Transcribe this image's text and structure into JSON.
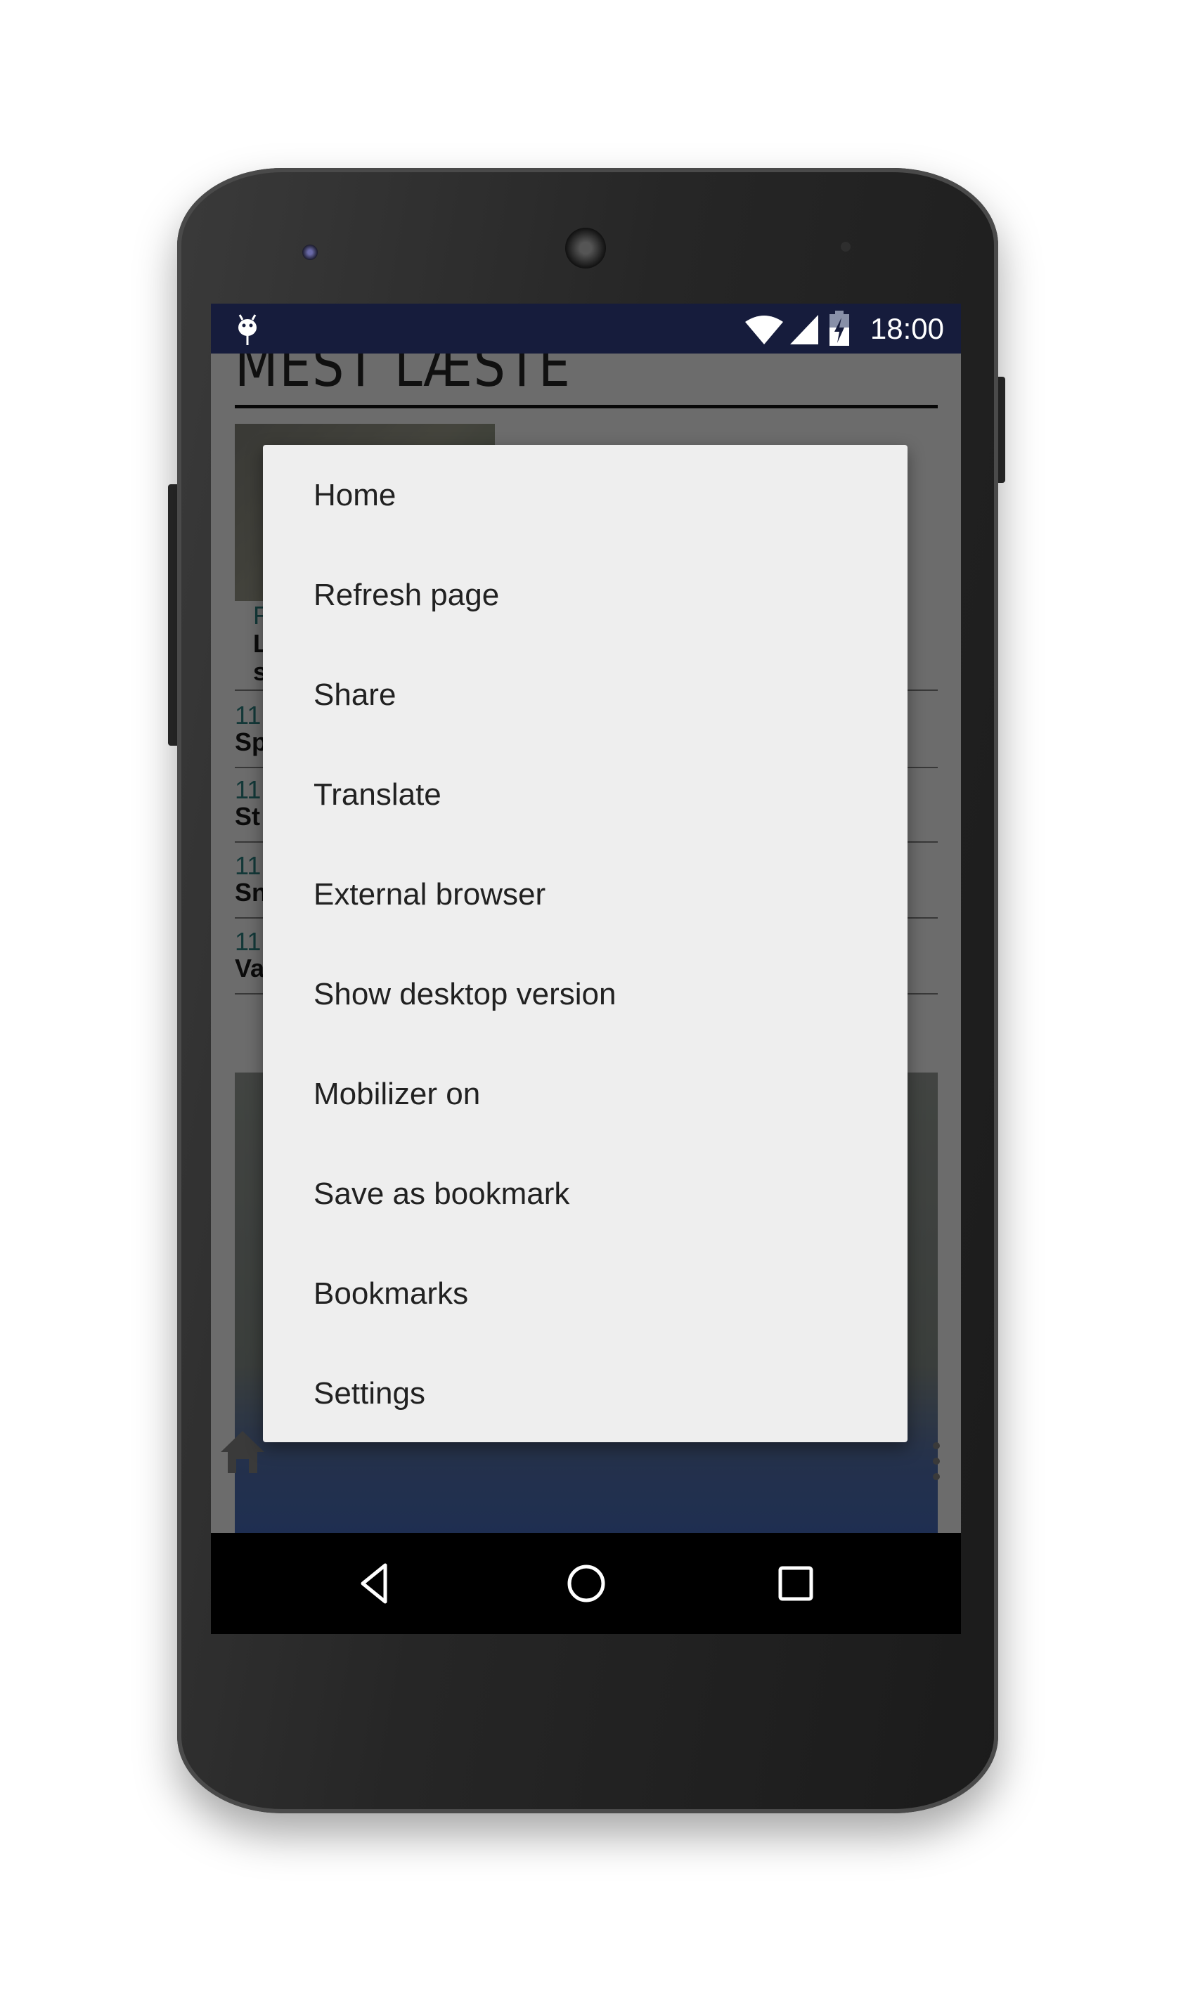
{
  "status_bar": {
    "time": "18:00",
    "notification_icon": "android-debug-icon",
    "icons": [
      "wifi-icon",
      "cell-signal-icon",
      "battery-charging-icon"
    ]
  },
  "background_page": {
    "headline": "MEST LÆSTE",
    "rows": [
      {
        "time": "11",
        "title": "Sp"
      },
      {
        "time": "11",
        "title": "St"
      },
      {
        "time": "11",
        "title": "Sn"
      },
      {
        "time": "11",
        "title": "Va"
      }
    ],
    "featured_fragment": {
      "kicker": "F",
      "line1": "L",
      "line2": "s"
    }
  },
  "menu": {
    "items": [
      {
        "label": "Home"
      },
      {
        "label": "Refresh page"
      },
      {
        "label": "Share"
      },
      {
        "label": "Translate"
      },
      {
        "label": "External browser"
      },
      {
        "label": "Show desktop version"
      },
      {
        "label": "Mobilizer on"
      },
      {
        "label": "Save as bookmark"
      },
      {
        "label": "Bookmarks"
      },
      {
        "label": "Settings"
      }
    ]
  },
  "colors": {
    "status_bar": "#161c3c",
    "menu_bg": "#eeeeee",
    "scrim": "#6c6c6c",
    "link_teal": "#1f5a5a"
  }
}
